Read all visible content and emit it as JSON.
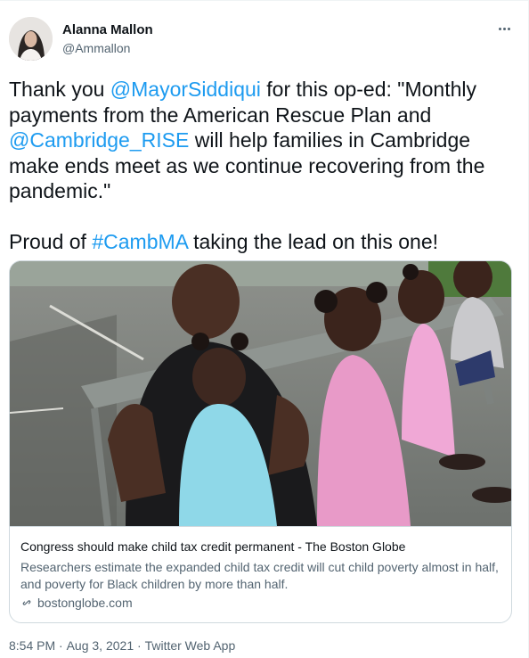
{
  "author": {
    "name": "Alanna Mallon",
    "handle": "@Ammallon"
  },
  "tweet": {
    "p1_a": "Thank you ",
    "mention_1": "@MayorSiddiqui",
    "p1_b": " for this op-ed: \"Monthly payments from the American Rescue Plan and ",
    "mention_2": "@Cambridge_RISE",
    "p1_c": " will help families in Cambridge make ends meet as we continue recovering from the pandemic.\"",
    "p2_a": "Proud of ",
    "hashtag": "#CambMA",
    "p2_b": " taking the lead on this one!"
  },
  "card": {
    "title": "Congress should make child tax credit permanent - The Boston Globe",
    "description": "Researchers estimate the expanded child tax credit will cut child poverty almost in half, and poverty for Black children by more than half.",
    "domain": "bostonglobe.com",
    "domain_icon": "link-icon",
    "image_icon": "family-photo"
  },
  "meta": {
    "time": "8:54 PM",
    "sep1": " · ",
    "date": "Aug 3, 2021",
    "sep2": " · ",
    "source": "Twitter Web App"
  },
  "colors": {
    "link": "#1d9bf0",
    "secondary_text": "#536471",
    "primary_text": "#0f1419",
    "border": "#cfd9de"
  }
}
